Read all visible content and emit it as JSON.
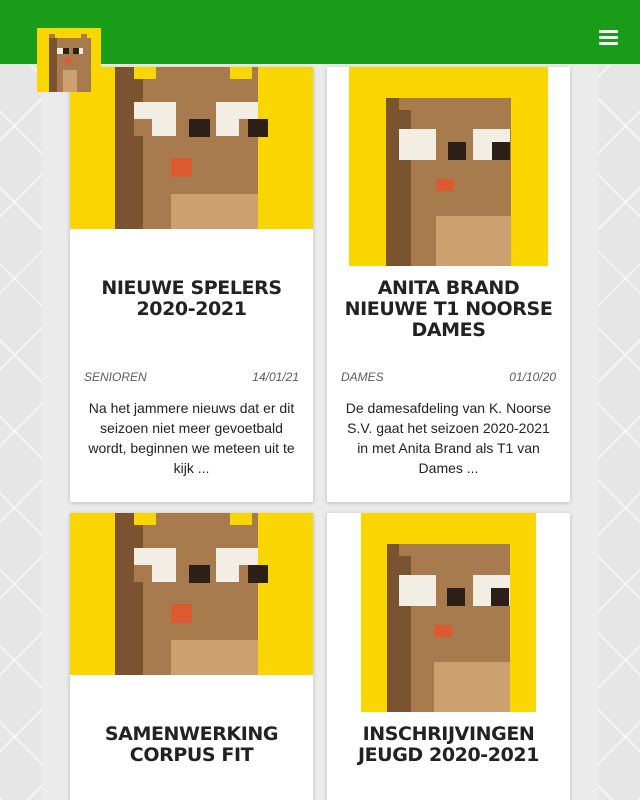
{
  "header": {
    "logo": "otter-pixel-logo",
    "menu_icon": "hamburger-menu-icon",
    "bar_color": "#199d19"
  },
  "posts": [
    {
      "title": "Nieuwe spelers 2020-2021",
      "category": "Senioren",
      "date": "14/01/21",
      "excerpt": "Na het jammere nieuws dat er dit seizoen niet meer gevoetbald wordt, beginnen we meteen uit te kijk ..."
    },
    {
      "title": "Anita Brand nieuwe T1 Noorse Dames",
      "category": "Dames",
      "date": "01/10/20",
      "excerpt": "De damesafdeling van K. Noorse S.V. gaat het seizoen 2020-2021 in met Anita Brand als T1 van Dames ..."
    },
    {
      "title": "Samenwerking Corpus Fit"
    },
    {
      "title": "Inschrijvingen jeugd 2020-2021"
    }
  ],
  "colors": {
    "thumb_background": "#f9d600",
    "mascot_fur": "#a77b4e",
    "mascot_dark": "#7a5430",
    "mascot_belly": "#cda06f",
    "mascot_nose": "#dc5a2f"
  }
}
